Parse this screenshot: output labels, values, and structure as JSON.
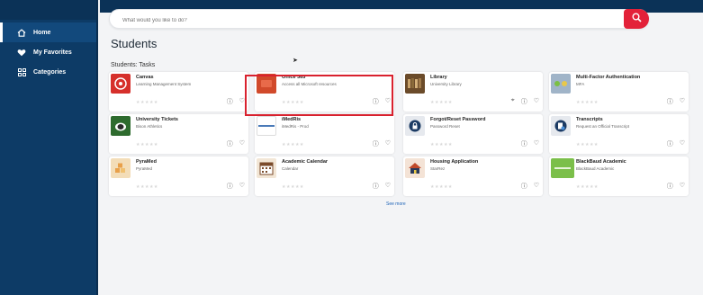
{
  "sidebar": {
    "items": [
      {
        "label": "Home",
        "icon": "home-icon",
        "active": true
      },
      {
        "label": "My Favorites",
        "icon": "heart-icon",
        "active": false
      },
      {
        "label": "Categories",
        "icon": "grid-icon",
        "active": false
      }
    ]
  },
  "search": {
    "placeholder": "What would you like to do?"
  },
  "page": {
    "title": "Students",
    "section": "Students: Tasks"
  },
  "cards": [
    {
      "title": "Canvas",
      "subtitle": "Learning Management System",
      "logo_color": "#d6302b"
    },
    {
      "title": "Office 365",
      "subtitle": "Access all Microsoft resources",
      "logo_color": "#d14a2b"
    },
    {
      "title": "Library",
      "subtitle": "University Library",
      "logo_color": "#6b4b2a"
    },
    {
      "title": "Multi-Factor Authentication",
      "subtitle": "MFA",
      "logo_color": "#a0b4c8"
    },
    {
      "title": "University Tickets",
      "subtitle": "Bison Athletics",
      "logo_color": "#2e6b2e"
    },
    {
      "title": "iMedRis",
      "subtitle": "iMedRis - Prod",
      "logo_color": "#ffffff"
    },
    {
      "title": "Forgot/Reset Password",
      "subtitle": "Password Reset",
      "logo_color": "#1c3b64"
    },
    {
      "title": "Transcripts",
      "subtitle": "Request an Official Transcript",
      "logo_color": "#1c3b64"
    },
    {
      "title": "PyraMed",
      "subtitle": "PyraMed",
      "logo_color": "#e8a04a"
    },
    {
      "title": "Academic Calendar",
      "subtitle": "Calendar",
      "logo_color": "#7a4a2a"
    },
    {
      "title": "Housing Application",
      "subtitle": "StarRez",
      "logo_color": "#c04a2a"
    },
    {
      "title": "BlackBaud Academic",
      "subtitle": "BlackBaud Academic",
      "logo_color": "#7bbf4a"
    }
  ],
  "stars": "★★★★★",
  "see_more": "See more"
}
